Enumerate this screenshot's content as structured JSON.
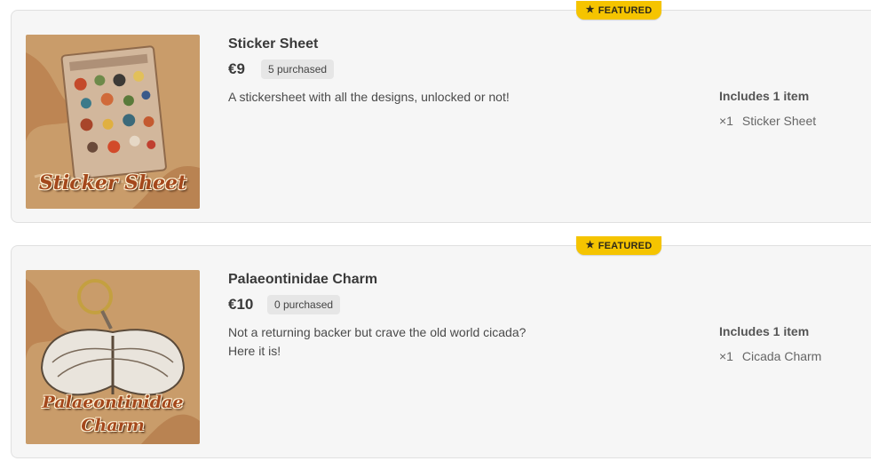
{
  "products": [
    {
      "featured_label": "FEATURED",
      "title": "Sticker Sheet",
      "price": "€9",
      "purchased": "5 purchased",
      "description": [
        "A stickersheet with all the designs, unlocked or not!"
      ],
      "includes_label": "Includes 1 item",
      "items": [
        {
          "qty": "×1",
          "name": "Sticker Sheet"
        }
      ],
      "image_text": [
        "Sticker Sheet"
      ]
    },
    {
      "featured_label": "FEATURED",
      "title": "Palaeontinidae Charm",
      "price": "€10",
      "purchased": "0 purchased",
      "description": [
        "Not a returning backer but crave the old world cicada?",
        "Here it is!"
      ],
      "includes_label": "Includes 1 item",
      "items": [
        {
          "qty": "×1",
          "name": "Cicada Charm"
        }
      ],
      "image_text": [
        "Palaeontinidae",
        "Charm"
      ]
    }
  ],
  "colors": {
    "featured_badge": "#f5c400",
    "card_background": "#f6f6f6",
    "image_background": "#c99c6a",
    "image_text": "#a4481c"
  },
  "icons": {
    "badge": "star-icon"
  }
}
